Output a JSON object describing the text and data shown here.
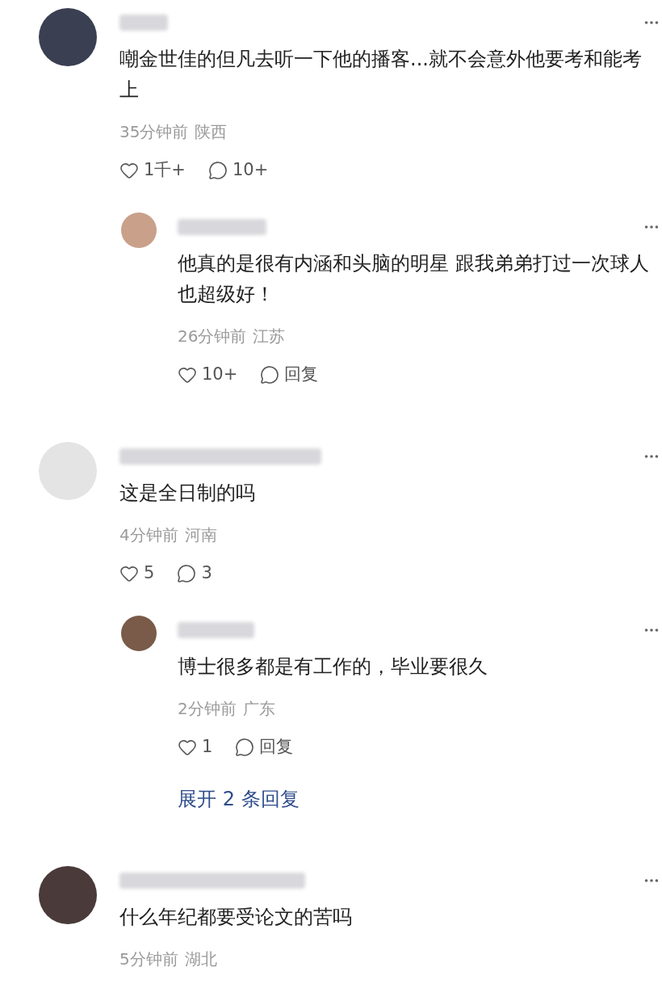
{
  "comments": [
    {
      "text": "嘲金世佳的但凡去听一下他的播客...就不会意外他要考和能考上",
      "time": "35分钟前",
      "location": "陕西",
      "likes": "1千+",
      "replies_label": "10+",
      "children": [
        {
          "text": "他真的是很有内涵和头脑的明星 跟我弟弟打过一次球人也超级好！",
          "time": "26分钟前",
          "location": "江苏",
          "likes": "10+",
          "replies_label": "回复"
        }
      ]
    },
    {
      "text": "这是全日制的吗",
      "time": "4分钟前",
      "location": "河南",
      "likes": "5",
      "replies_label": "3",
      "children": [
        {
          "text": "博士很多都是有工作的，毕业要很久",
          "time": "2分钟前",
          "location": "广东",
          "likes": "1",
          "replies_label": "回复"
        }
      ],
      "expand_label": "展开 2 条回复"
    },
    {
      "text": "什么年纪都要受论文的苦吗",
      "time": "5分钟前",
      "location": "湖北"
    }
  ]
}
